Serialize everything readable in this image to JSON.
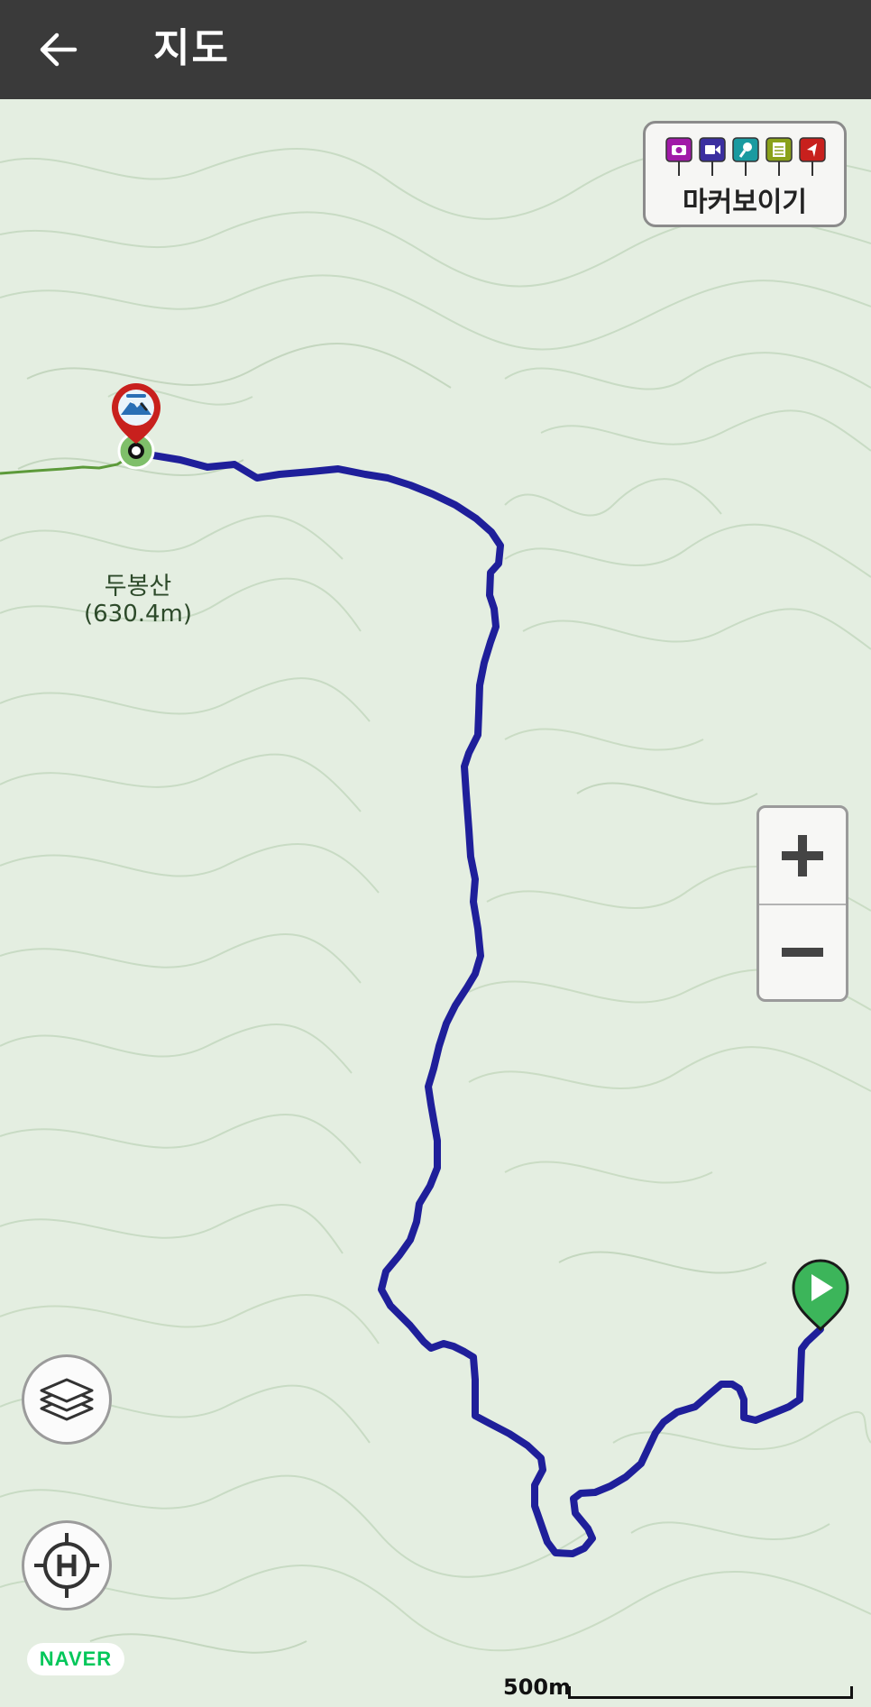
{
  "appbar": {
    "title": "지도",
    "back_icon": "arrow-left-icon"
  },
  "marker_toggle": {
    "label": "마커보이기",
    "icons": [
      {
        "name": "camera-marker-icon",
        "color": "#a11aa8"
      },
      {
        "name": "video-marker-icon",
        "color": "#3b2fa0"
      },
      {
        "name": "microphone-marker-icon",
        "color": "#1a9aa0"
      },
      {
        "name": "memo-marker-icon",
        "color": "#8aa11a"
      },
      {
        "name": "flag-marker-icon",
        "color": "#c8201d"
      }
    ]
  },
  "peak": {
    "name": "두봉산",
    "elevation": "(630.4m)"
  },
  "zoom": {
    "in_icon": "plus-icon",
    "out_icon": "minus-icon"
  },
  "controls": {
    "layers_icon": "layers-icon",
    "locate_icon": "helipad-target-icon"
  },
  "branding": {
    "naver": "NAVER"
  },
  "scale": {
    "label": "500m"
  },
  "colors": {
    "track": "#1f1f9a",
    "trail": "#5c9a3a",
    "start_marker": "#3cb55a",
    "summit_marker": "#c8201d",
    "map_bg": "#e4eee1",
    "contour": "#c5d8c0",
    "appbar": "#3a3a3a"
  }
}
